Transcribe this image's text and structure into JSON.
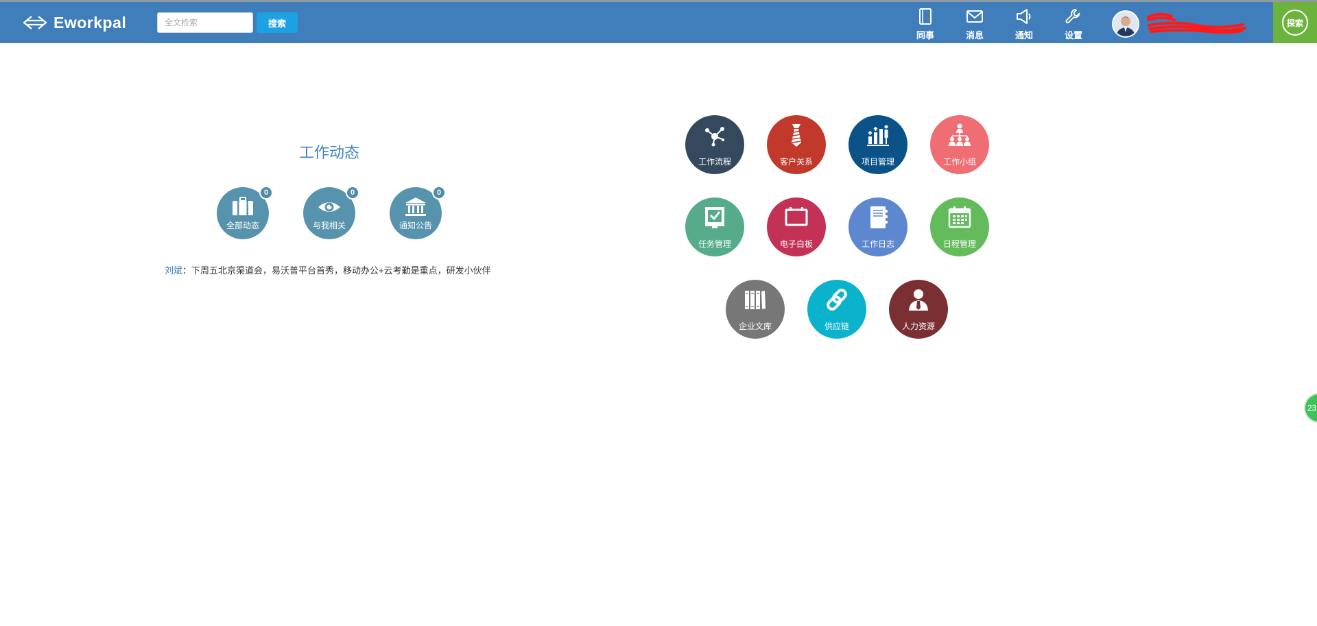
{
  "brand": {
    "name": "Eworkpal",
    "logo_icon": "eworkpal-arrows-logo-icon"
  },
  "search": {
    "placeholder": "全文检索",
    "value": "",
    "button_label": "搜索"
  },
  "nav": [
    {
      "id": "colleague",
      "label": "同事",
      "icon": "notebook-icon"
    },
    {
      "id": "message",
      "label": "消息",
      "icon": "envelope-icon"
    },
    {
      "id": "notice",
      "label": "通知",
      "icon": "megaphone-icon"
    },
    {
      "id": "settings",
      "label": "设置",
      "icon": "wrench-icon"
    }
  ],
  "user": {
    "avatar_icon": "user-avatar",
    "name_redacted": true
  },
  "explore": {
    "label": "探索"
  },
  "dynamics": {
    "title": "工作动态",
    "items": [
      {
        "label": "全部动态",
        "count": "0",
        "icon": "briefcase-icon"
      },
      {
        "label": "与我相关",
        "count": "0",
        "icon": "eye-icon"
      },
      {
        "label": "通知公告",
        "count": "0",
        "icon": "bank-icon"
      }
    ],
    "feed": {
      "author": "刘斌",
      "separator": "：",
      "text": "下周五北京渠道会，易沃普平台首秀，移动办公+云考勤是重点，研发小伙伴"
    }
  },
  "apps": [
    {
      "label": "工作流程",
      "color": "#34495e",
      "icon": "workflow-nodes-icon"
    },
    {
      "label": "客户关系",
      "color": "#c0392b",
      "icon": "tie-icon"
    },
    {
      "label": "项目管理",
      "color": "#0a5287",
      "icon": "growth-chart-icon"
    },
    {
      "label": "工作小组",
      "color": "#ee6e73",
      "icon": "team-org-icon"
    },
    {
      "label": "任务管理",
      "color": "#55ab8a",
      "icon": "task-check-icon"
    },
    {
      "label": "电子白板",
      "color": "#c33156",
      "icon": "whiteboard-icon"
    },
    {
      "label": "工作日志",
      "color": "#5d87cf",
      "icon": "journal-icon"
    },
    {
      "label": "日程管理",
      "color": "#64bb5c",
      "icon": "calendar-icon"
    },
    {
      "label": "企业文库",
      "color": "#777777",
      "icon": "books-icon"
    },
    {
      "label": "供应链",
      "color": "#0ab2cc",
      "icon": "chain-link-icon"
    },
    {
      "label": "人力资源",
      "color": "#7a2f33",
      "icon": "person-tie-icon"
    }
  ],
  "floating": {
    "label": "23",
    "color": "#3ec35a"
  }
}
